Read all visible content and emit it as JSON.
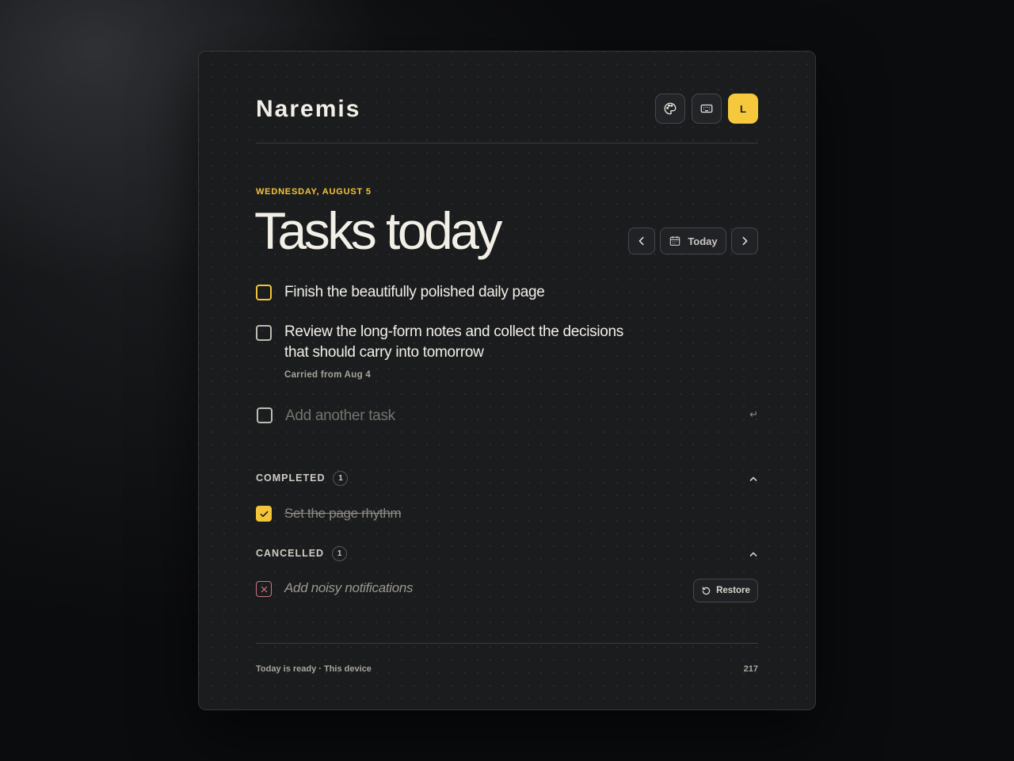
{
  "app": {
    "name": "Naremis"
  },
  "header": {
    "theme_icon": "palette-icon",
    "keyboard_icon": "keyboard-icon",
    "avatar_initial": "L"
  },
  "page": {
    "date_label": "WEDNESDAY, AUGUST 5",
    "title": "Tasks today",
    "today_label": "Today"
  },
  "tasks": [
    {
      "text": "Finish the beautifully polished daily page",
      "state": "focused"
    },
    {
      "text": "Review the long-form notes and collect the decisions that should carry into tomorrow",
      "line1": "Review the long-form notes and collect the decisions",
      "line2": "that should carry into tomorrow",
      "meta": "Carried from Aug 4"
    }
  ],
  "add_task": {
    "placeholder": "Add another task",
    "enter_hint": "↵"
  },
  "completed": {
    "label": "COMPLETED",
    "count": "1",
    "items": [
      {
        "text": "Set the page rhythm"
      }
    ]
  },
  "cancelled": {
    "label": "CANCELLED",
    "count": "1",
    "items": [
      {
        "text": "Add noisy notifications",
        "restore_label": "Restore"
      }
    ]
  },
  "footer": {
    "status": "Today is ready · This device",
    "count": "217"
  },
  "colors": {
    "accent": "#f3c43a",
    "background": "#1b1c1e",
    "text": "#f1efe6",
    "cancel": "#c9787e"
  }
}
